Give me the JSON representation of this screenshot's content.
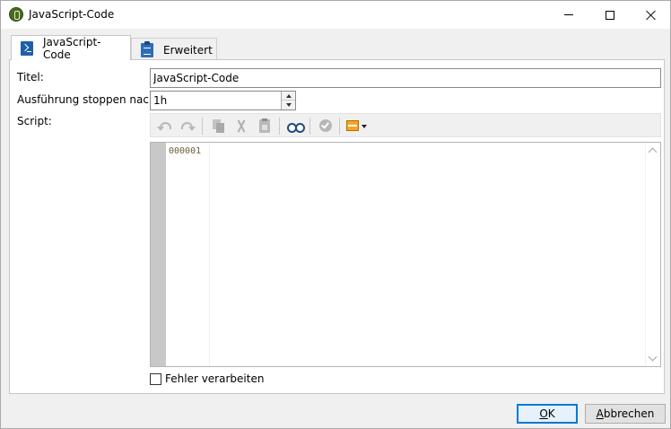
{
  "window": {
    "title": "JavaScript-Code"
  },
  "tabs": [
    {
      "label": "JavaScript-Code",
      "icon": "script-icon",
      "active": true
    },
    {
      "label": "Erweitert",
      "icon": "clipboard-icon",
      "active": false
    }
  ],
  "form": {
    "title_label": "Titel:",
    "title_value": "JavaScript-Code",
    "stop_label": "Ausführung stoppen nach:",
    "stop_value": "1h",
    "script_label": "Script:"
  },
  "toolbar": {
    "icons": [
      "undo-icon",
      "redo-icon",
      "copy-icon",
      "cut-icon",
      "paste-icon",
      "find-icon",
      "check-icon",
      "insert-icon"
    ]
  },
  "editor": {
    "line_numbers": "000001",
    "content": ""
  },
  "options": {
    "error_label": "Fehler verarbeiten",
    "error_checked": false
  },
  "buttons": {
    "ok_mnemonic": "O",
    "ok_rest": "K",
    "cancel_mnemonic": "A",
    "cancel_rest": "bbrechen"
  }
}
